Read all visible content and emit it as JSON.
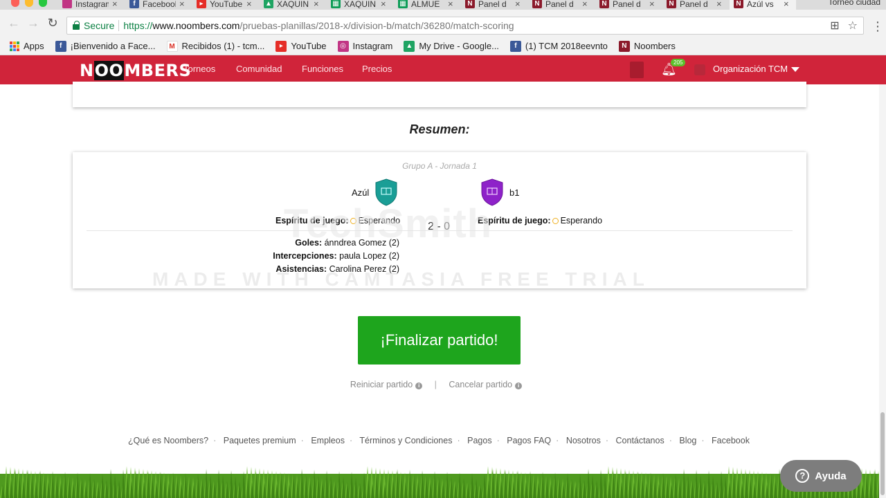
{
  "browser": {
    "tabs": [
      {
        "title": "Instagram",
        "icon": "instagram-icon",
        "color": "#c13584"
      },
      {
        "title": "Facebook",
        "icon": "facebook-icon",
        "color": "#3b5998"
      },
      {
        "title": "YouTube",
        "icon": "youtube-icon",
        "color": "#e52d27"
      },
      {
        "title": "XAQUIN",
        "icon": "google-drive-icon",
        "color": "#1fa463"
      },
      {
        "title": "XAQUIN",
        "icon": "google-sheets-icon",
        "color": "#0f9d58"
      },
      {
        "title": "ALMUE",
        "icon": "google-sheets-icon",
        "color": "#0f9d58"
      },
      {
        "title": "Panel d",
        "icon": "noombers-icon",
        "color": "#8b1a2b"
      },
      {
        "title": "Panel d",
        "icon": "noombers-icon",
        "color": "#8b1a2b"
      },
      {
        "title": "Panel d",
        "icon": "noombers-icon",
        "color": "#8b1a2b"
      },
      {
        "title": "Panel d",
        "icon": "noombers-icon",
        "color": "#8b1a2b"
      },
      {
        "title": "Azúl vs",
        "icon": "noombers-icon",
        "color": "#8b1a2b"
      }
    ],
    "profile_label": "Torneo ciudad",
    "secure_label": "Secure",
    "url": {
      "scheme": "https://",
      "host": "www.noombers.com",
      "path": "/pruebas-planillas/2018-x/division-b/match/36280/match-scoring"
    },
    "bookmarks": [
      {
        "label": "Apps",
        "icon": "apps-grid-icon"
      },
      {
        "label": "¡Bienvenido a Face...",
        "icon": "facebook-icon"
      },
      {
        "label": "Recibidos (1) - tcm...",
        "icon": "gmail-icon"
      },
      {
        "label": "YouTube",
        "icon": "youtube-icon"
      },
      {
        "label": "Instagram",
        "icon": "instagram-icon"
      },
      {
        "label": "My Drive - Google...",
        "icon": "google-drive-icon"
      },
      {
        "label": "(1) TCM 2018eevnto",
        "icon": "facebook-icon"
      },
      {
        "label": "Noombers",
        "icon": "noombers-icon"
      }
    ]
  },
  "site": {
    "logo": {
      "pre": "N",
      "mid": "OO",
      "post": "MBERS"
    },
    "nav": [
      "Torneos",
      "Comunidad",
      "Funciones",
      "Precios"
    ],
    "notifications": "205",
    "org": "Organización TCM",
    "brand_color": "#d0243a"
  },
  "summary": {
    "heading": "Resumen:",
    "group": "Grupo A - Jornada 1",
    "home": {
      "name": "Azúl",
      "color": "#1a9e96"
    },
    "away": {
      "name": "b1",
      "color": "#8e22c9"
    },
    "spirit_label": "Espíritu de juego:",
    "home_spirit": "Esperando",
    "away_spirit": "Esperando",
    "score": "2 - 0",
    "stats": [
      {
        "label": "Goles:",
        "value": "ánndrea Gomez (2)"
      },
      {
        "label": "Intercepciones:",
        "value": "paula Lopez (2)"
      },
      {
        "label": "Asistencias:",
        "value": "Carolina Perez (2)"
      }
    ]
  },
  "actions": {
    "finish": "¡Finalizar partido!",
    "restart": "Reiniciar partido",
    "separator": "|",
    "cancel": "Cancelar partido",
    "accent": "#1ea51d"
  },
  "footer": [
    "¿Qué es Noombers?",
    "Paquetes premium",
    "Empleos",
    "Términos y Condiciones",
    "Pagos",
    "Pagos FAQ",
    "Nosotros",
    "Contáctanos",
    "Blog",
    "Facebook"
  ],
  "help": {
    "label": "Ayuda",
    "icon": "question-icon"
  },
  "watermark": {
    "logo": "TechSmith",
    "subtitle": "MADE WITH CAMTASIA FREE TRIAL"
  }
}
